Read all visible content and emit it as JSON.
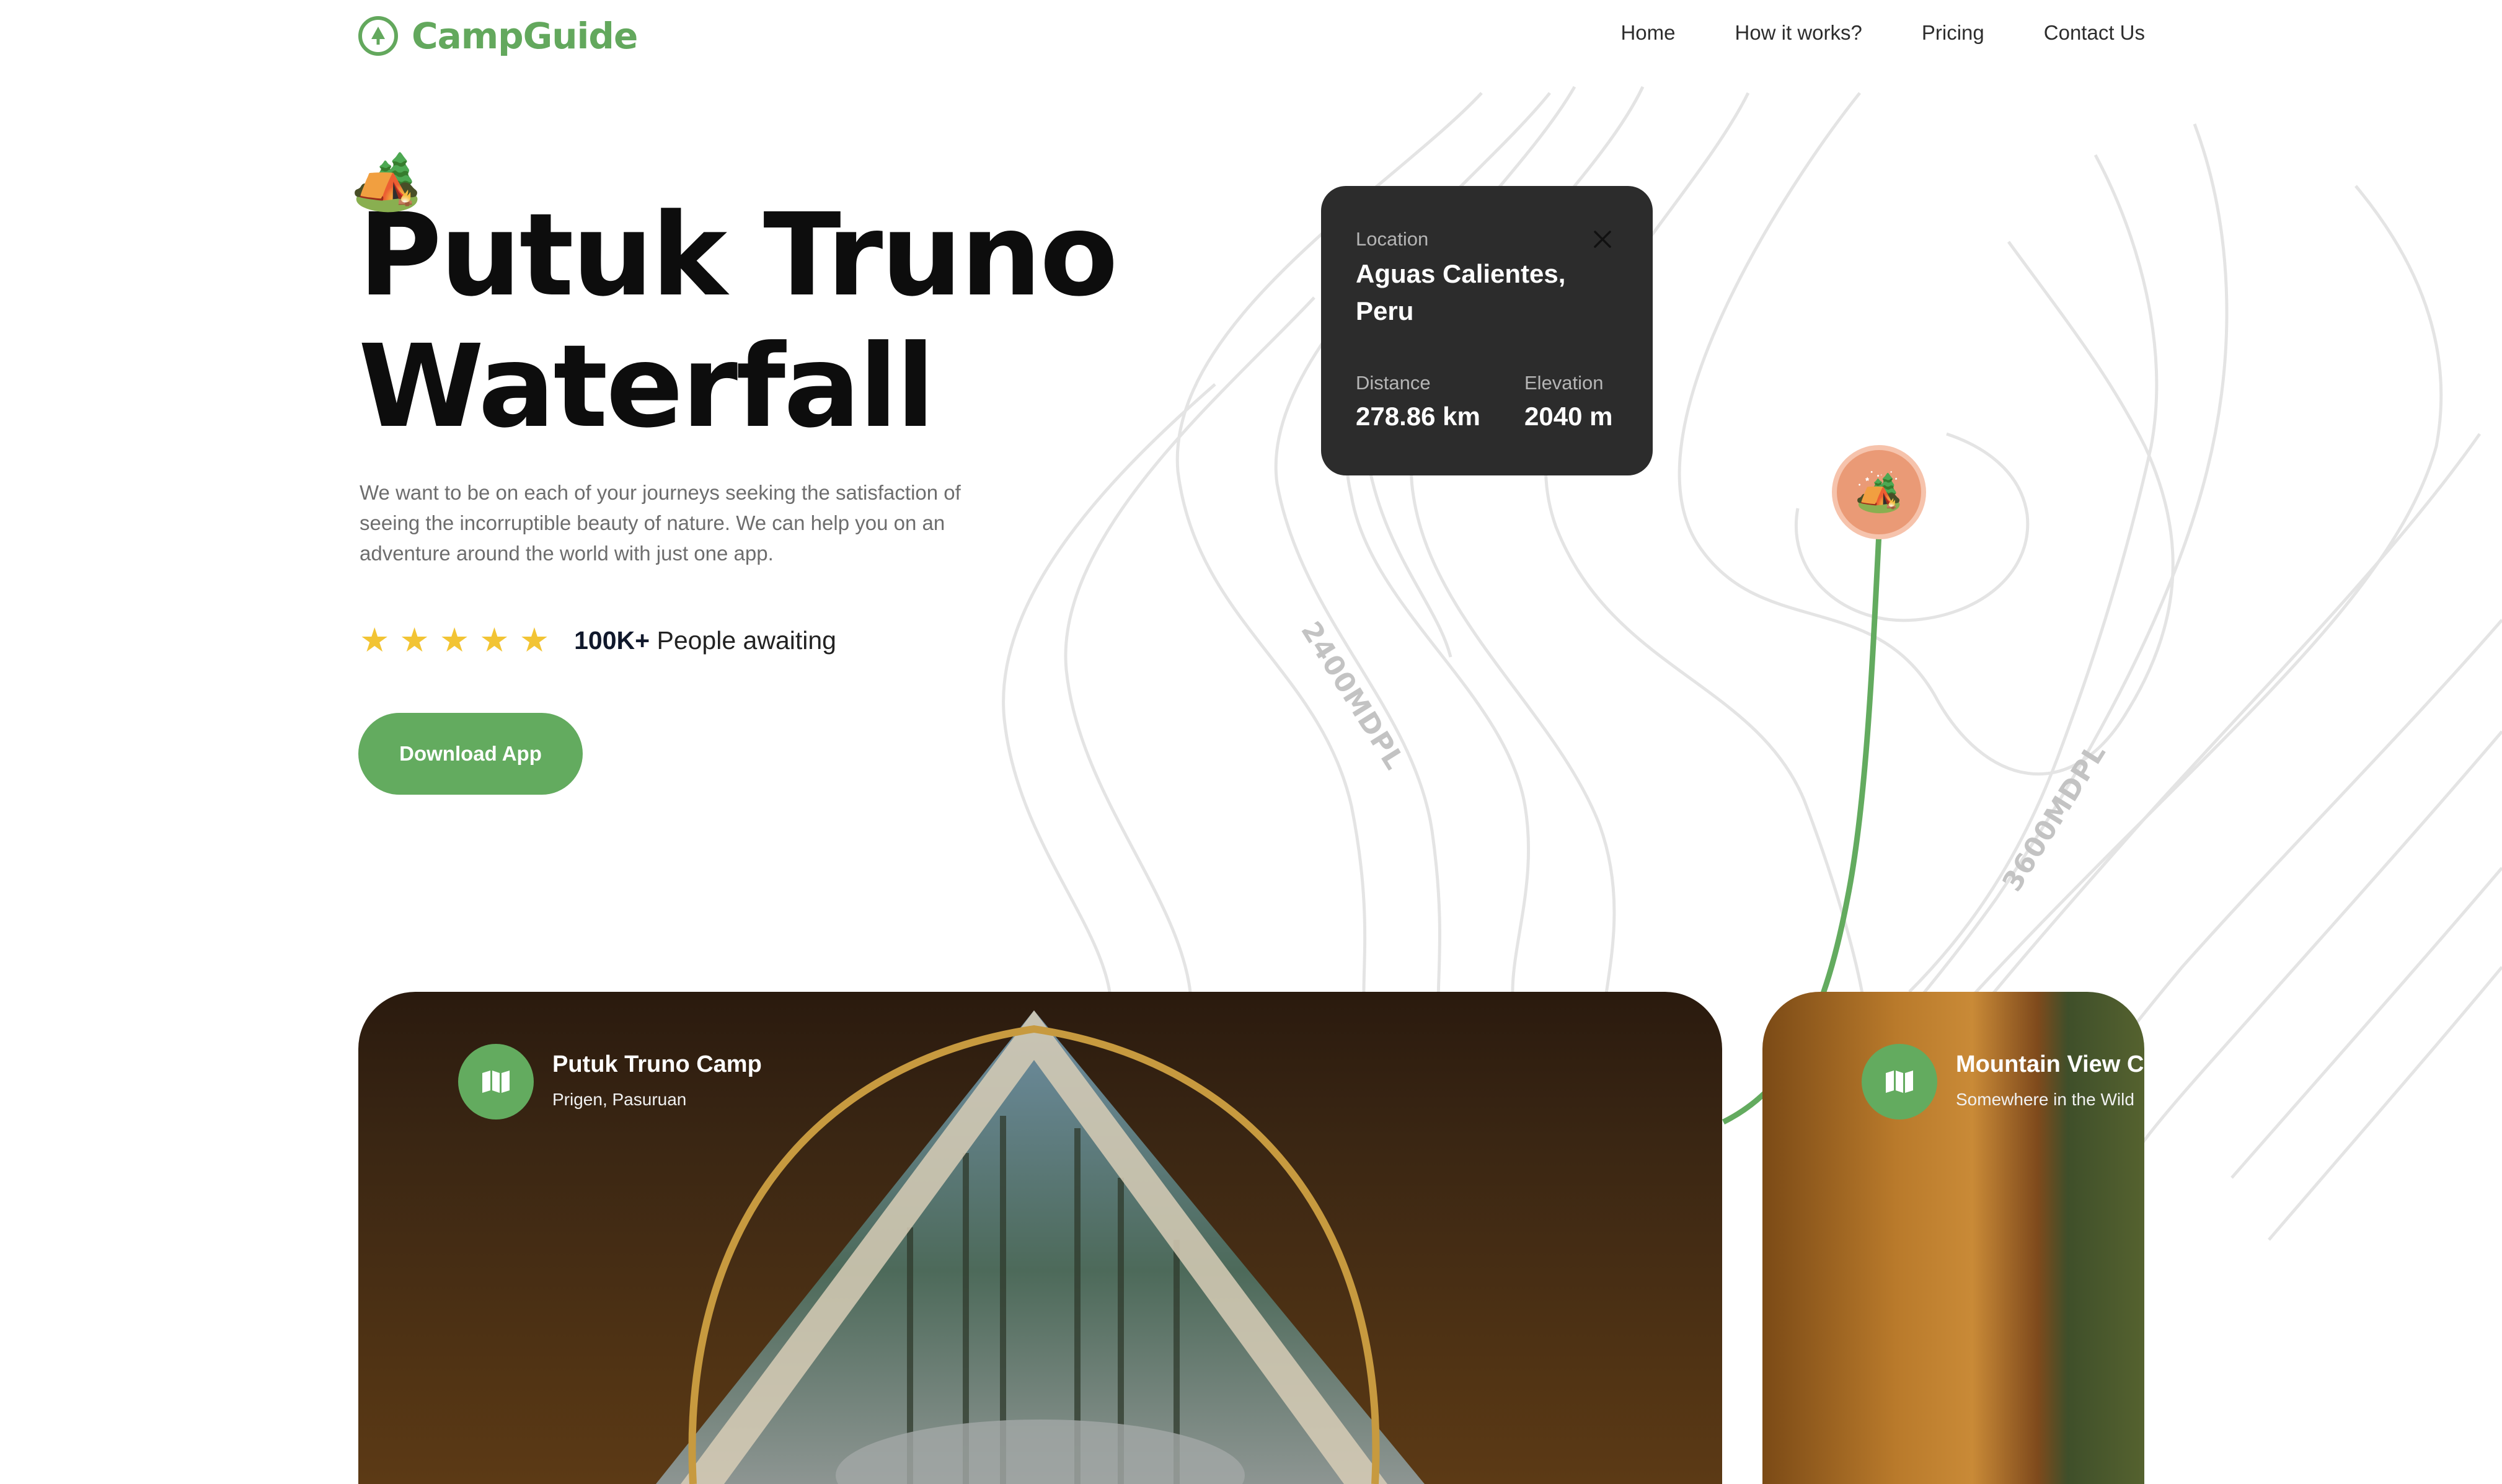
{
  "brand": {
    "name": "CampGuide",
    "logo_icon": "tree-in-circle-icon",
    "color": "#63a85d"
  },
  "nav": {
    "items": [
      {
        "label": "Home"
      },
      {
        "label": "How it works?"
      },
      {
        "label": "Pricing"
      },
      {
        "label": "Contact Us"
      }
    ]
  },
  "hero": {
    "emoji": "🏕️",
    "title_line1": "Putuk Truno",
    "title_line2": "Waterfall",
    "description": "We want to be on each of your journeys seeking the satisfaction of seeing the incorruptible beauty of nature. We can help you on an adventure around the world with just one app.",
    "rating": {
      "stars": 5,
      "count": "100K+",
      "text": "People awaiting",
      "star_color": "#f2c434"
    },
    "cta_label": "Download App",
    "cta_color": "#63ab5f"
  },
  "info_card": {
    "location_label": "Location",
    "location_value": "Aguas Calientes, Peru",
    "distance_label": "Distance",
    "distance_value": "278.86 km",
    "elevation_label": "Elevation",
    "elevation_value": "2040 m",
    "close_icon": "close-icon"
  },
  "map": {
    "marker_emoji": "🏕️",
    "marker_color": "#ea9a76",
    "route_color": "#63ab5f",
    "contour_labels": [
      "2400MDPL",
      "3600MDPL"
    ]
  },
  "cards": [
    {
      "title": "Putuk Truno Camp",
      "subtitle": "Prigen, Pasuruan",
      "icon": "map-icon"
    },
    {
      "title": "Mountain View Camp",
      "subtitle": "Somewhere in the Wild",
      "icon": "map-icon"
    }
  ]
}
